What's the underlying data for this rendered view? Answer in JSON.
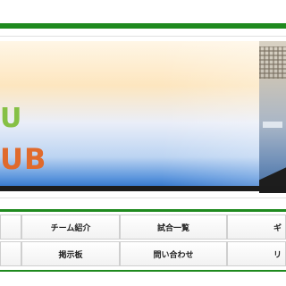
{
  "header": {
    "logo_line1": "U",
    "logo_line2": "UB",
    "colors": {
      "accent_green": "#1f8a1f",
      "logo_green": "#86c045",
      "logo_orange": "#e06a2c"
    }
  },
  "nav": {
    "row1": [
      {
        "label": ""
      },
      {
        "label": "チーム紹介"
      },
      {
        "label": "試合一覧"
      },
      {
        "label": "ギ"
      }
    ],
    "row2": [
      {
        "label": ""
      },
      {
        "label": "掲示板"
      },
      {
        "label": "問い合わせ"
      },
      {
        "label": "リ"
      }
    ]
  }
}
